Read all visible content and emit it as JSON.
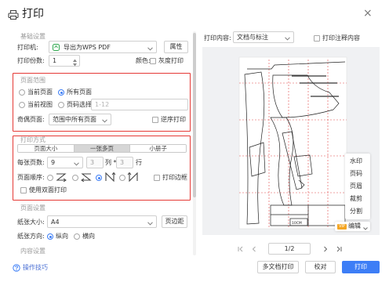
{
  "window": {
    "title": "打印",
    "close_label": "×"
  },
  "basic": {
    "section_label": "基础设置",
    "printer_label": "打印机:",
    "printer_value": "导出为WPS PDF",
    "properties_button": "属性",
    "copies_label": "打印份数:",
    "copies_value": "1",
    "color_label": "颜色:",
    "grayscale_label": "灰度打印",
    "grayscale_checked": false
  },
  "page_range": {
    "section_label": "页面范围",
    "options": [
      {
        "label": "当前页面",
        "checked": false
      },
      {
        "label": "所有页面",
        "checked": true
      },
      {
        "label": "当前视图",
        "checked": false
      },
      {
        "label": "页码选择:",
        "checked": false
      }
    ],
    "page_select_placeholder": "1-12",
    "odd_even_label": "奇偶页面:",
    "odd_even_value": "范围中所有页面",
    "reverse_label": "逆序打印",
    "reverse_checked": false
  },
  "print_mode": {
    "section_label": "打印方式",
    "tabs": [
      {
        "label": "页面大小",
        "active": false
      },
      {
        "label": "一张多页",
        "active": true
      },
      {
        "label": "小册子",
        "active": false
      }
    ],
    "pages_per_sheet_label": "每张页数:",
    "pages_per_sheet_value": "9",
    "columns_value": "3",
    "columns_label": "列 *",
    "rows_value": "3",
    "rows_label": "行",
    "page_order_label": "页面顺序:",
    "page_order_options": [
      {
        "icon": "order-z-icon",
        "checked": false
      },
      {
        "icon": "order-z-reverse-icon",
        "checked": false
      },
      {
        "icon": "order-n-icon",
        "checked": true
      },
      {
        "icon": "order-n-reverse-icon",
        "checked": false
      }
    ],
    "border_label": "打印边框",
    "border_checked": false,
    "duplex_label": "使用双面打印",
    "duplex_checked": false
  },
  "page_setup": {
    "section_label": "页面设置",
    "paper_size_label": "纸张大小:",
    "paper_size_value": "A4",
    "margins_button": "页边距",
    "orientation_label": "纸张方向:",
    "orientation_options": [
      {
        "label": "纵向",
        "checked": true
      },
      {
        "label": "横向",
        "checked": false
      }
    ]
  },
  "content_setup": {
    "section_label": "内容设置"
  },
  "tips": {
    "label": "操作技巧",
    "icon": "tips-icon"
  },
  "print_content": {
    "label": "打印内容:",
    "value": "文档与标注",
    "annotations_label": "打印注释内容",
    "annotations_checked": false
  },
  "preview": {
    "scale_label": "10CM",
    "tools": [
      "水印",
      "页码",
      "页眉",
      "裁剪",
      "分割"
    ],
    "vip_badge": "VIP",
    "edit_label": "编辑"
  },
  "pagination": {
    "value": "1/2"
  },
  "buttons": {
    "multi_doc": "多文档打印",
    "proofread": "校对",
    "print": "打印"
  },
  "colors": {
    "accent": "#3d7ef6",
    "highlight_border": "#e53935",
    "vip_badge": "#f5a623",
    "print_button": "#3d7ef6"
  }
}
